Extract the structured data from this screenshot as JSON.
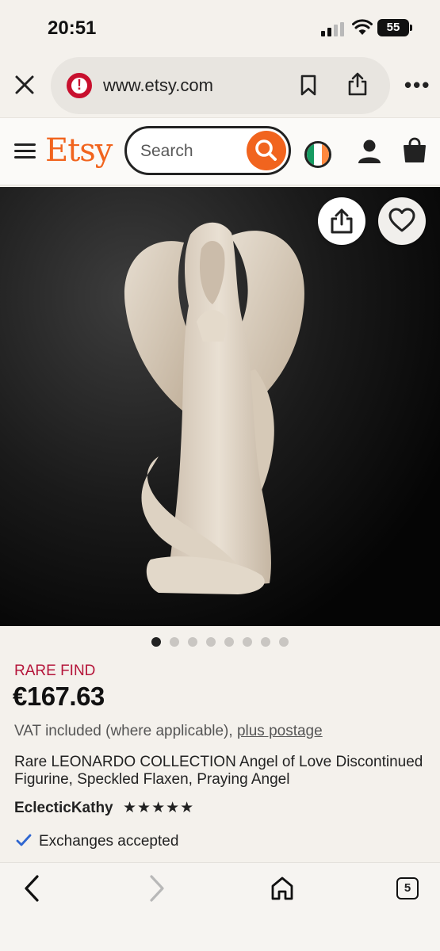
{
  "status_bar": {
    "time": "20:51",
    "battery": "55"
  },
  "browser": {
    "url": "www.etsy.com"
  },
  "header": {
    "logo": "Etsy",
    "search_placeholder": "Search",
    "flag_colors": [
      "#169b62",
      "#ffffff",
      "#ff883e"
    ]
  },
  "gallery": {
    "image_count": 8,
    "active_index": 0
  },
  "listing": {
    "badge": "RARE FIND",
    "price": "€167.63",
    "vat_text": "VAT included (where applicable), ",
    "postage_link": "plus postage",
    "title": "Rare LEONARDO COLLECTION Angel of Love Discontinued Figurine, Speckled Flaxen, Praying Angel",
    "shop_name": "EclecticKathy",
    "stars": "★★★★★",
    "rating": 5,
    "exchanges": "Exchanges accepted"
  },
  "toolbar": {
    "tab_count": "5"
  },
  "colors": {
    "accent": "#f1641e",
    "rare": "#b5153a",
    "check": "#2f66d0"
  }
}
